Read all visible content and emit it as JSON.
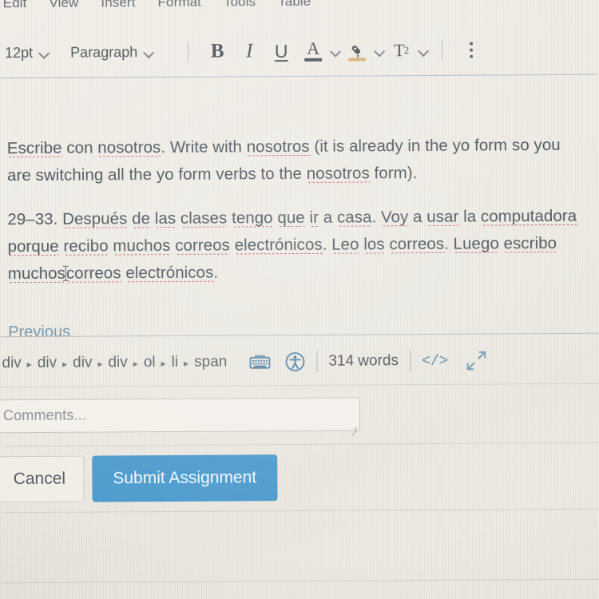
{
  "menubar": {
    "items": [
      {
        "label": "Edit"
      },
      {
        "label": "View"
      },
      {
        "label": "Insert"
      },
      {
        "label": "Format"
      },
      {
        "label": "Tools"
      },
      {
        "label": "Table"
      }
    ]
  },
  "toolbar": {
    "font_size": "12pt",
    "block_format": "Paragraph",
    "bold_label": "B",
    "italic_label": "I",
    "underline_label": "U",
    "text_color_label": "A",
    "superscript_label": "T",
    "superscript_exponent": "2",
    "highlight_color": "#d8b277",
    "overflow_label": ""
  },
  "document": {
    "paragraph_1": {
      "s1": "Escribe",
      "t1": " con ",
      "s2": "nosotros",
      "t2": ". Write with ",
      "s3": "nosotros",
      "t3": " (it is already in the yo form so you are switching all the yo form verbs to the ",
      "s4": "nosotros",
      "t4": " form)."
    },
    "paragraph_2": {
      "num": "29–33. ",
      "w1": "Después",
      "g1": " ",
      "w2": "de",
      "g2": " ",
      "w3": "las",
      "g3": " ",
      "w4": "clases",
      "g4": " ",
      "w5": "tengo",
      "g5": " ",
      "w6": "que",
      "g6": " ",
      "w7": "ir",
      "g7": " a ",
      "w8": "casa",
      "g8": ". ",
      "w9": "Voy",
      "g9": " a ",
      "w10": "usar",
      "g10": " la ",
      "w11": "computadora",
      "g11": " ",
      "w12": "porque",
      "g12": " ",
      "w13": "recibo",
      "g13": " ",
      "w14": "muchos",
      "g14": " ",
      "w15": "correos",
      "g15": " ",
      "w16": "electrónicos",
      "g16": ". ",
      "w17": "Leo",
      "g17": " ",
      "w18": "los",
      "g18": " ",
      "w19": "correos",
      "g19": ". ",
      "w20": "Luego",
      "g20": " ",
      "w21": "escribo",
      "g21": " ",
      "w22": "muchos",
      "g22": "",
      "w23": "correos",
      "g23": " ",
      "w24": "electrónicos",
      "g24": "."
    }
  },
  "previous_link": {
    "label": "Previous"
  },
  "statusbar": {
    "breadcrumb": [
      "div",
      "div",
      "div",
      "div",
      "ol",
      "li",
      "span"
    ],
    "separator": "▸",
    "word_count": "314 words",
    "html_editor_label": "</>",
    "keyboard_icon": "keyboard-shortcuts-icon",
    "accessibility_icon": "accessibility-checker-icon",
    "fullscreen_icon": "fullscreen-expand-icon",
    "icon_color": "#4d7fa6"
  },
  "comments": {
    "placeholder": "Comments...",
    "value": ""
  },
  "actions": {
    "cancel_label": "Cancel",
    "submit_label": "Submit Assignment",
    "submit_color": "#4d9bcd"
  }
}
